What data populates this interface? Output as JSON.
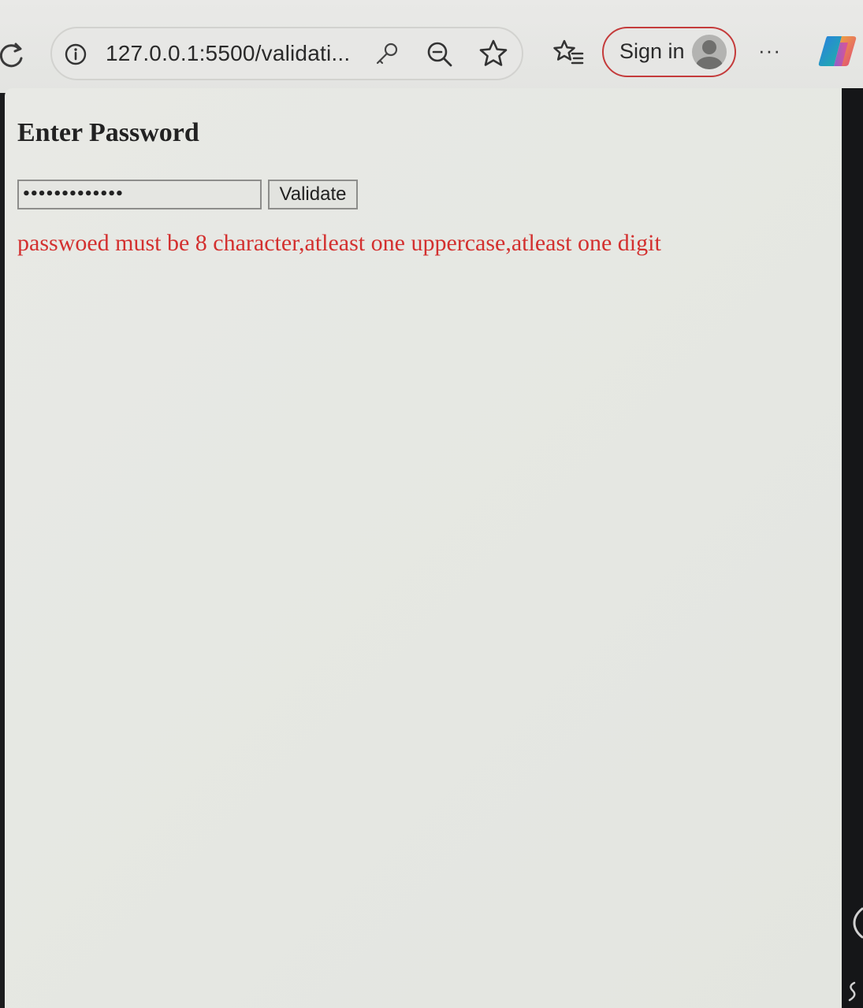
{
  "browser": {
    "url": "127.0.0.1:5500/validati...",
    "signin_label": "Sign in",
    "more_label": "···",
    "icons": {
      "reload": "reload-icon",
      "info": "info-icon",
      "password_key": "key-icon",
      "zoom_out": "zoom-out-icon",
      "favorite": "star-icon",
      "favorites": "favorites-icon",
      "profile": "avatar-icon",
      "more": "more-icon",
      "copilot": "copilot-icon"
    },
    "colors": {
      "signin_border": "#c43b3b"
    }
  },
  "page": {
    "heading": "Enter Password",
    "password_value": "•••••••••••••",
    "validate_label": "Validate",
    "error_message": "passwoed must be 8 character,atleast one uppercase,atleast one digit",
    "colors": {
      "error": "#d3302f"
    }
  }
}
